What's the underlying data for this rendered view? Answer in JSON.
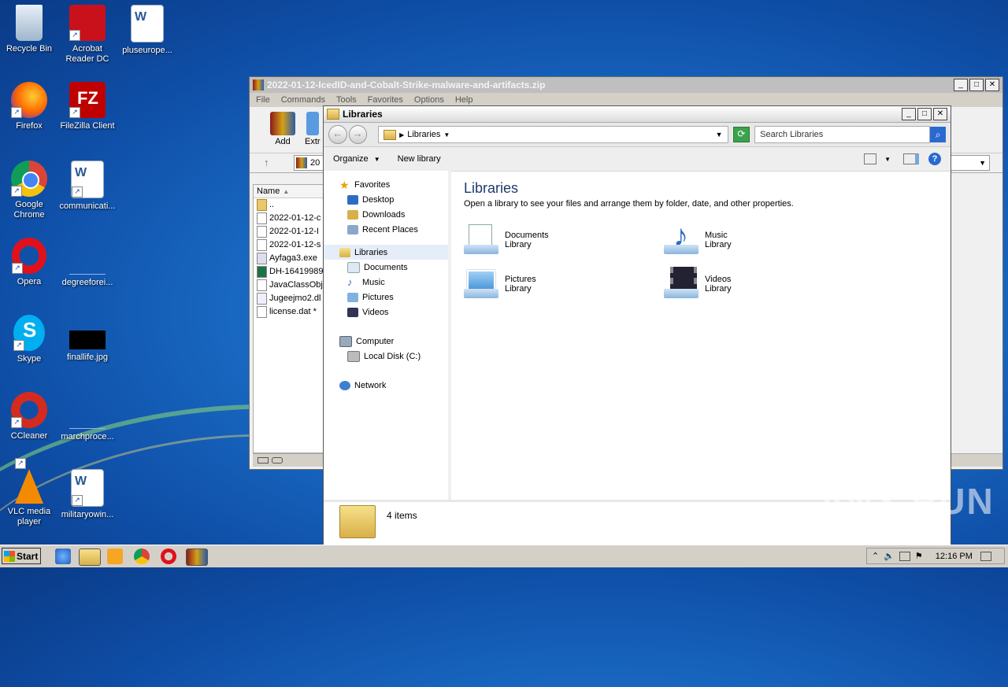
{
  "desktop": {
    "icons": [
      {
        "label": "Recycle Bin",
        "icon": "recycle-bin-icon"
      },
      {
        "label": "Acrobat Reader DC",
        "icon": "acrobat-icon"
      },
      {
        "label": "pluseurope...",
        "icon": "word-doc-icon"
      },
      {
        "label": "Firefox",
        "icon": "firefox-icon"
      },
      {
        "label": "FileZilla Client",
        "icon": "filezilla-icon"
      },
      {
        "label": "Google Chrome",
        "icon": "chrome-icon"
      },
      {
        "label": "communicati...",
        "icon": "word-doc-icon"
      },
      {
        "label": "Opera",
        "icon": "opera-icon"
      },
      {
        "label": "degreeforei...",
        "icon": "blank-file-icon"
      },
      {
        "label": "Skype",
        "icon": "skype-icon"
      },
      {
        "label": "finallife.jpg",
        "icon": "image-file-icon"
      },
      {
        "label": "CCleaner",
        "icon": "ccleaner-icon"
      },
      {
        "label": "marchproce...",
        "icon": "blank-file-icon"
      },
      {
        "label": "VLC media player",
        "icon": "vlc-icon"
      },
      {
        "label": "militaryowin...",
        "icon": "word-doc-icon"
      }
    ]
  },
  "winrar": {
    "title": "2022-01-12-IcedID-and-Cobalt-Strike-malware-and-artifacts.zip",
    "menu": [
      "File",
      "Commands",
      "Tools",
      "Favorites",
      "Options",
      "Help"
    ],
    "toolbar": {
      "add": "Add",
      "extract": "Extr"
    },
    "address": "20",
    "column_name": "Name",
    "files": [
      "..",
      "2022-01-12-c",
      "2022-01-12-I",
      "2022-01-12-s",
      "Ayfaga3.exe",
      "DH-16419989",
      "JavaClassObj",
      "Jugeejmo2.dl",
      "license.dat *"
    ]
  },
  "libraries": {
    "title": "Libraries",
    "address": "Libraries",
    "search_placeholder": "Search Libraries",
    "organize": "Organize",
    "new_library": "New library",
    "nav": {
      "favorites": "Favorites",
      "desktop": "Desktop",
      "downloads": "Downloads",
      "recent": "Recent Places",
      "libraries": "Libraries",
      "documents": "Documents",
      "music": "Music",
      "pictures": "Pictures",
      "videos": "Videos",
      "computer": "Computer",
      "local_disk": "Local Disk (C:)",
      "network": "Network"
    },
    "heading": "Libraries",
    "subtitle": "Open a library to see your files and arrange them by folder, date, and other properties.",
    "tiles": [
      {
        "name": "Documents",
        "type": "Library"
      },
      {
        "name": "Music",
        "type": "Library"
      },
      {
        "name": "Pictures",
        "type": "Library"
      },
      {
        "name": "Videos",
        "type": "Library"
      }
    ],
    "status": "4 items"
  },
  "taskbar": {
    "start": "Start",
    "clock": "12:16 PM"
  },
  "watermark": "ANY RUN"
}
